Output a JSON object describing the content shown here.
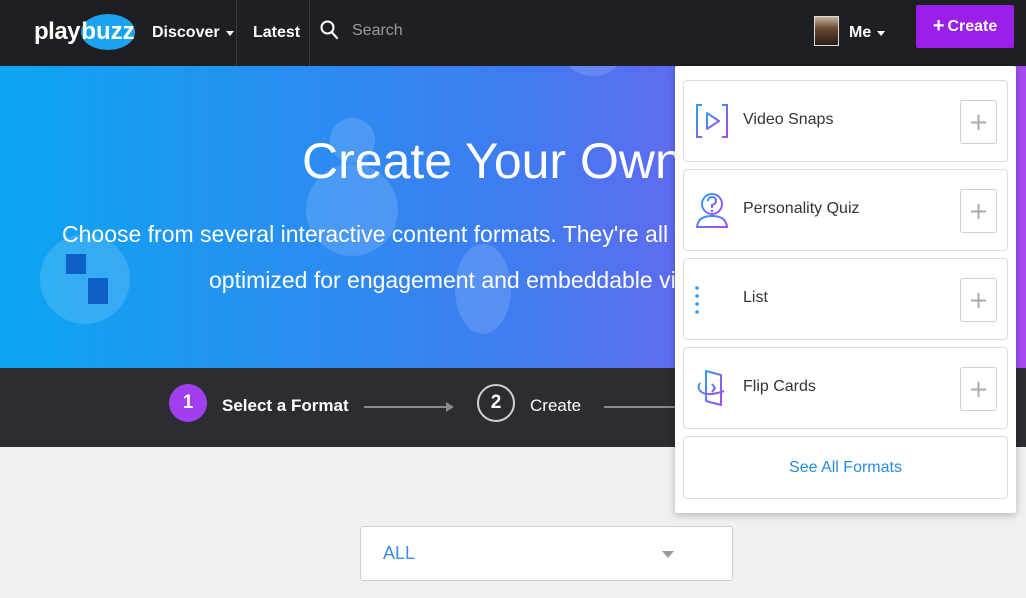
{
  "header": {
    "logo_play": "play",
    "logo_buzz": "buzz",
    "discover_label": "Discover",
    "latest_label": "Latest",
    "search_placeholder": "Search",
    "me_label": "Me",
    "create_label": "Create",
    "create_icon": "+"
  },
  "hero": {
    "title": "Create Your Own B",
    "subtitle_line1": "Choose from several interactive content formats. They're all free",
    "subtitle_line2": "optimized for engagement and embeddable virtu"
  },
  "steps": [
    {
      "number": "1",
      "label": "Select a Format",
      "active": true
    },
    {
      "number": "2",
      "label": "Create",
      "active": false
    }
  ],
  "filter": {
    "selected": "ALL"
  },
  "dropdown": {
    "formats": [
      {
        "label": "Video Snaps",
        "icon": "video-play-icon",
        "add": "+"
      },
      {
        "label": "Personality Quiz",
        "icon": "person-question-icon",
        "add": "+"
      },
      {
        "label": "List",
        "icon": "list-icon",
        "add": "+"
      },
      {
        "label": "Flip Cards",
        "icon": "flip-cards-icon",
        "add": "+"
      }
    ],
    "see_all_label": "See All Formats"
  },
  "colors": {
    "accent_purple": "#9b1fe8",
    "link_blue": "#2a8ae0",
    "navbar_bg": "#1e1f22",
    "steps_bg": "#2b2d31"
  }
}
